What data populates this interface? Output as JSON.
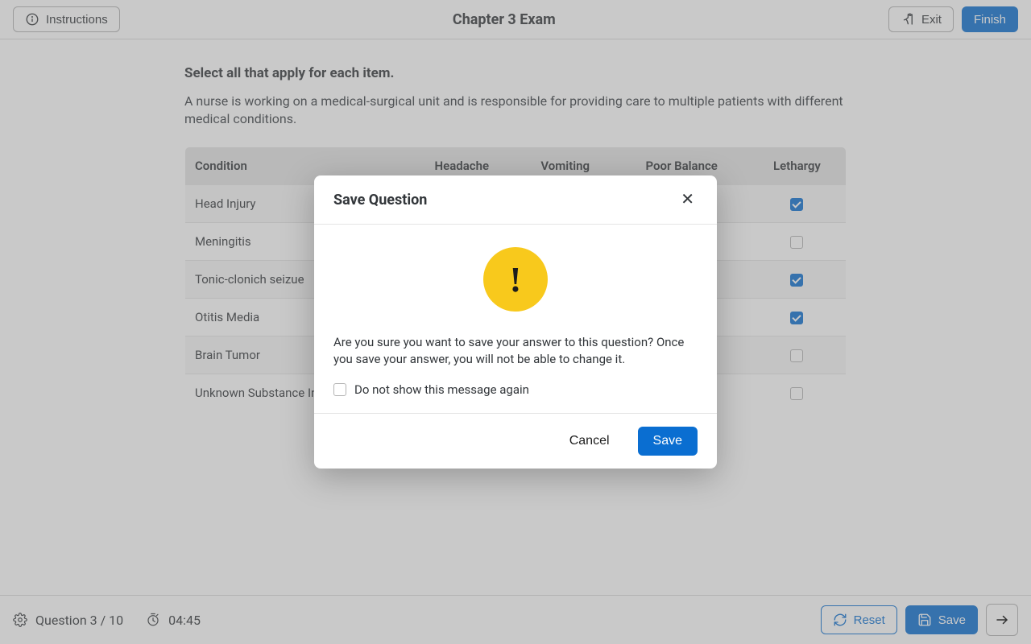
{
  "header": {
    "instructions_label": "Instructions",
    "title": "Chapter 3 Exam",
    "exit_label": "Exit",
    "finish_label": "Finish"
  },
  "question": {
    "directions": "Select all that apply for each item.",
    "scenario": "A nurse is working on a medical-surgical unit and is responsible for providing care to multiple patients with different medical conditions.",
    "columns": [
      "Condition",
      "Headache",
      "Vomiting",
      "Poor Balance",
      "Lethargy"
    ],
    "rows": [
      {
        "label": "Head Injury",
        "cells": [
          false,
          false,
          false,
          true
        ]
      },
      {
        "label": "Meningitis",
        "cells": [
          false,
          false,
          false,
          false
        ]
      },
      {
        "label": "Tonic-clonich seizue",
        "cells": [
          false,
          false,
          false,
          true
        ]
      },
      {
        "label": "Otitis Media",
        "cells": [
          false,
          false,
          false,
          true
        ]
      },
      {
        "label": "Brain Tumor",
        "cells": [
          false,
          false,
          false,
          false
        ]
      },
      {
        "label": "Unknown Substance Ingestion",
        "cells": [
          false,
          false,
          false,
          false
        ]
      }
    ]
  },
  "footer": {
    "progress_label": "Question 3 / 10",
    "timer_label": "04:45",
    "reset_label": "Reset",
    "save_label": "Save"
  },
  "modal": {
    "title": "Save Question",
    "body_text": "Are you sure you want to save your answer to this question? Once you save your answer, you will not be able to change it.",
    "dont_show_label": "Do not show this message again",
    "cancel_label": "Cancel",
    "save_label": "Save"
  }
}
